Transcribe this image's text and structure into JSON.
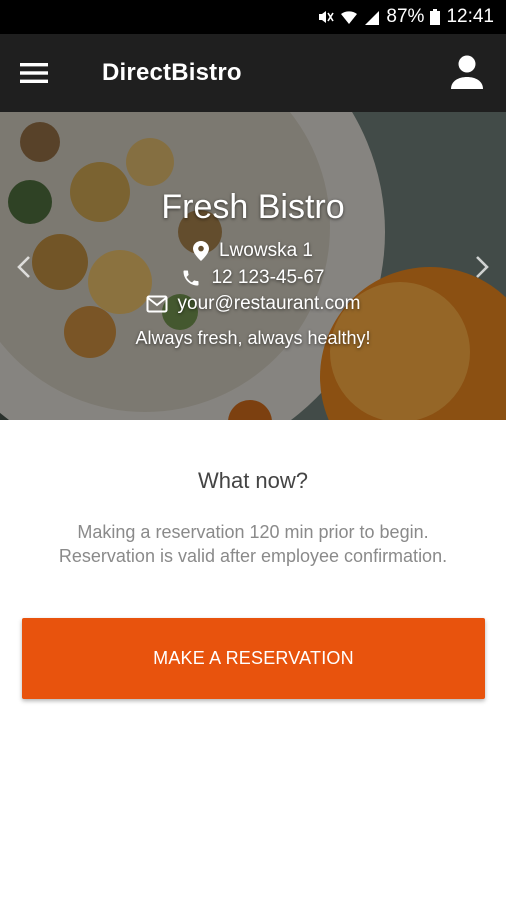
{
  "status_bar": {
    "battery": "87%",
    "time": "12:41",
    "icons": [
      "mute-icon",
      "wifi-icon",
      "signal-icon",
      "battery-icon"
    ]
  },
  "app_bar": {
    "title": "DirectBistro",
    "menu_icon": "hamburger-menu-icon",
    "account_icon": "account-icon",
    "background": "#1f1f1f"
  },
  "hero": {
    "title": "Fresh Bistro",
    "address": "Lwowska 1",
    "phone": "12 123-45-67",
    "email": "your@restaurant.com",
    "tagline": "Always fresh, always healthy!",
    "icons": [
      "location-pin-icon",
      "phone-icon",
      "mail-icon",
      "chevron-left-icon",
      "chevron-right-icon"
    ]
  },
  "content": {
    "heading": "What now?",
    "info_line1": "Making a reservation 120 min prior to begin.",
    "info_line2": "Reservation is valid after employee confirmation.",
    "button_label": "MAKE A RESERVATION",
    "accent_color": "#e8530d"
  }
}
